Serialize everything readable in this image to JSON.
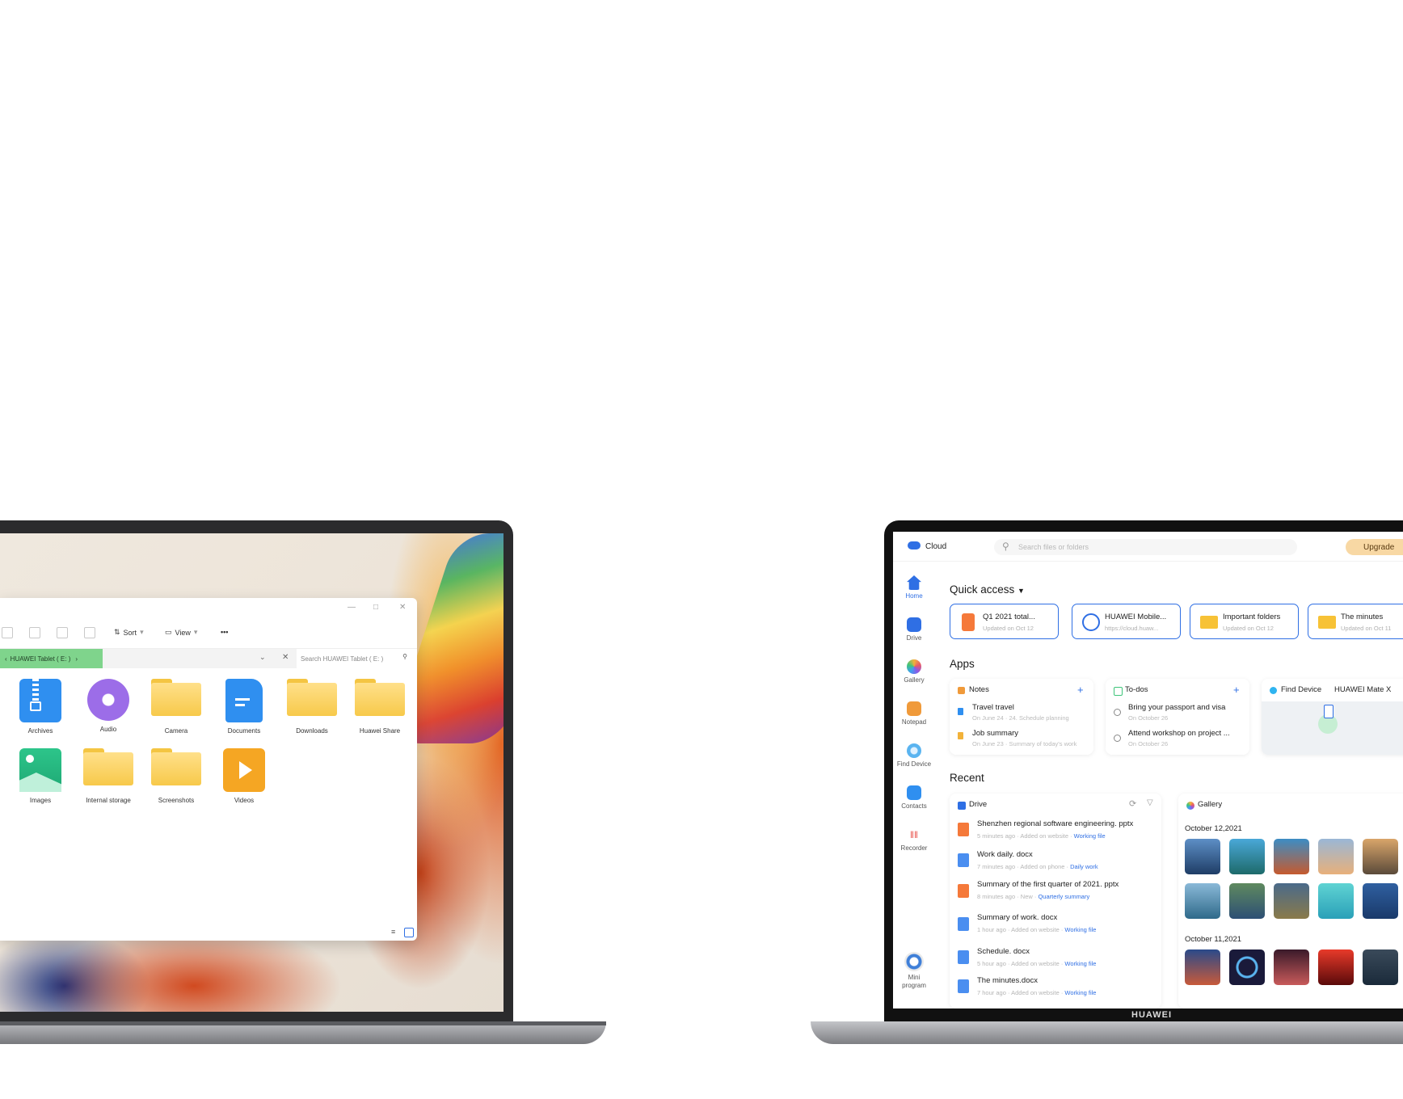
{
  "explorer": {
    "toolbar": {
      "sort_label": "Sort",
      "view_label": "View",
      "more_label": "•••"
    },
    "breadcrumb": "HUAWEI Tablet ( E: )",
    "search_placeholder": "Search HUAWEI Tablet ( E: )",
    "items": [
      {
        "label": "Archives",
        "icon": "archive-icon"
      },
      {
        "label": "Audio",
        "icon": "audio-icon"
      },
      {
        "label": "Camera",
        "icon": "folder-icon"
      },
      {
        "label": "Documents",
        "icon": "document-icon"
      },
      {
        "label": "Downloads",
        "icon": "folder-icon"
      },
      {
        "label": "Huawei Share",
        "icon": "folder-icon"
      },
      {
        "label": "Images",
        "icon": "image-icon"
      },
      {
        "label": "Internal storage",
        "icon": "folder-icon"
      },
      {
        "label": "Screenshots",
        "icon": "folder-icon"
      },
      {
        "label": "Videos",
        "icon": "video-icon"
      }
    ]
  },
  "cloud": {
    "app_name": "Cloud",
    "search_placeholder": "Search files or folders",
    "upgrade_label": "Upgrade",
    "sidebar": [
      {
        "label": "Home",
        "color": "#2f6fe4"
      },
      {
        "label": "Drive",
        "color": "#2f6fe4"
      },
      {
        "label": "Gallery",
        "color": "#e8a33a"
      },
      {
        "label": "Notepad",
        "color": "#f09a3a"
      },
      {
        "label": "Find Device",
        "color": "#5ab4f0"
      },
      {
        "label": "Contacts",
        "color": "#2f8ff0"
      },
      {
        "label": "Recorder",
        "color": "#e8504a"
      },
      {
        "label": "Mini program",
        "color": "#3f7fd8"
      }
    ],
    "quick_access": {
      "title": "Quick access",
      "cards": [
        {
          "title": "Q1 2021 total...",
          "sub": "Updated on Oct 12"
        },
        {
          "title": "HUAWEI Mobile...",
          "sub": "https://cloud.huaw..."
        },
        {
          "title": "Important folders",
          "sub": "Updated on Oct 12"
        },
        {
          "title": "The minutes",
          "sub": "Updated on Oct 11"
        }
      ]
    },
    "apps": {
      "title": "Apps",
      "notes": {
        "title": "Notes",
        "rows": [
          {
            "t": "Travel travel",
            "s": "On June 24 · 24. Schedule planning"
          },
          {
            "t": "Job summary",
            "s": "On June 23 · Summary of today's work"
          }
        ]
      },
      "todos": {
        "title": "To-dos",
        "rows": [
          {
            "t": "Bring your passport and visa",
            "s": "On October 26"
          },
          {
            "t": "Attend workshop on project ...",
            "s": "On October 26"
          }
        ]
      },
      "find_device": {
        "title": "Find Device",
        "device": "HUAWEI Mate X"
      }
    },
    "recent": {
      "title": "Recent",
      "drive_title": "Drive",
      "files": [
        {
          "name": "Shenzhen regional software engineering. pptx",
          "meta": "5 minutes ago · Added on website ·",
          "tag": "Working file",
          "type": "ppt"
        },
        {
          "name": "Work daily. docx",
          "meta": "7 minutes ago · Added on phone ·",
          "tag": "Daily work",
          "type": "doc"
        },
        {
          "name": "Summary of the first quarter of 2021. pptx",
          "meta": "8 minutes ago · New ·",
          "tag": "Quarterly summary",
          "type": "ppt"
        },
        {
          "name": "Summary of work. docx",
          "meta": "1 hour ago · Added on website ·",
          "tag": "Working file",
          "type": "doc"
        },
        {
          "name": "Schedule. docx",
          "meta": "5 hour ago · Added on website ·",
          "tag": "Working file",
          "type": "doc"
        },
        {
          "name": "The minutes.docx",
          "meta": "7 hour ago · Added on website ·",
          "tag": "Working file",
          "type": "doc"
        }
      ],
      "gallery_title": "Gallery",
      "dates": [
        "October 12,2021",
        "October 11,2021"
      ]
    },
    "brand": "HUAWEI"
  }
}
